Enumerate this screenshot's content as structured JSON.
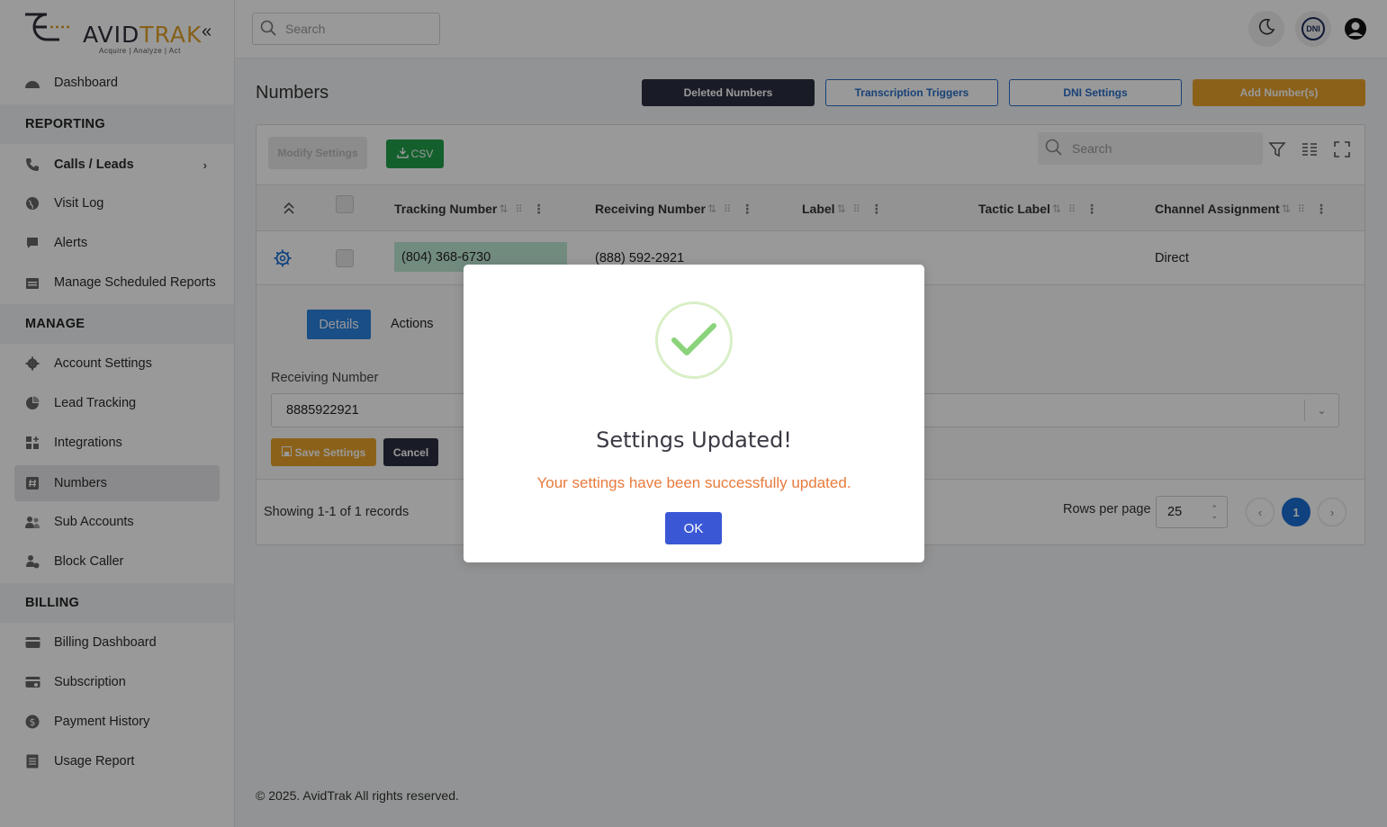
{
  "app": {
    "logo_prefix": "AVID",
    "logo_suffix": "TRAK",
    "logo_tagline": "Acquire  |  Analyze  |  Act"
  },
  "sidebar": {
    "dashboard": "Dashboard",
    "reporting_header": "REPORTING",
    "calls_leads": "Calls / Leads",
    "visit_log": "Visit Log",
    "alerts": "Alerts",
    "scheduled_reports": "Manage Scheduled Reports",
    "manage_header": "MANAGE",
    "account_settings": "Account Settings",
    "lead_tracking": "Lead Tracking",
    "integrations": "Integrations",
    "numbers": "Numbers",
    "sub_accounts": "Sub Accounts",
    "block_caller": "Block Caller",
    "billing_header": "BILLING",
    "billing_dashboard": "Billing Dashboard",
    "subscription": "Subscription",
    "payment_history": "Payment History",
    "usage_report": "Usage Report"
  },
  "topbar": {
    "search_placeholder": "Search",
    "dni_badge": "DNI"
  },
  "page": {
    "title": "Numbers",
    "deleted_numbers": "Deleted Numbers",
    "transcription_triggers": "Transcription Triggers",
    "dni_settings": "DNI Settings",
    "add_numbers": "Add Number(s)"
  },
  "table": {
    "modify_settings": "Modify Settings",
    "csv": "CSV",
    "search_placeholder": "Search",
    "columns": {
      "tracking_number": "Tracking Number",
      "receiving_number": "Receiving Number",
      "label": "Label",
      "tactic_label": "Tactic Label",
      "channel_assignment": "Channel Assignment"
    },
    "row": {
      "tracking_number": "(804) 368-6730",
      "receiving_number": "(888) 592-2921",
      "label": "",
      "tactic_label": "",
      "channel_assignment": "Direct"
    },
    "detail": {
      "tab_details": "Details",
      "tab_actions": "Actions",
      "receiving_label": "Receiving Number",
      "receiving_value": "8885922921",
      "save_settings": "Save Settings",
      "cancel": "Cancel"
    },
    "footer": {
      "showing": "Showing 1-1 of 1 records",
      "rows_per_page_label": "Rows per page",
      "rows_per_page": "25",
      "current_page": "1"
    }
  },
  "footer": {
    "copyright": "© 2025. AvidTrak All rights reserved."
  },
  "modal": {
    "title": "Settings Updated!",
    "message": "Your settings have been successfully updated.",
    "ok": "OK"
  },
  "colors": {
    "brand_orange": "#e8a22c",
    "primary_blue": "#2b82e0",
    "success_green": "#7ccf6b",
    "message_orange": "#e87b3d",
    "ok_blue": "#3a58d6"
  }
}
